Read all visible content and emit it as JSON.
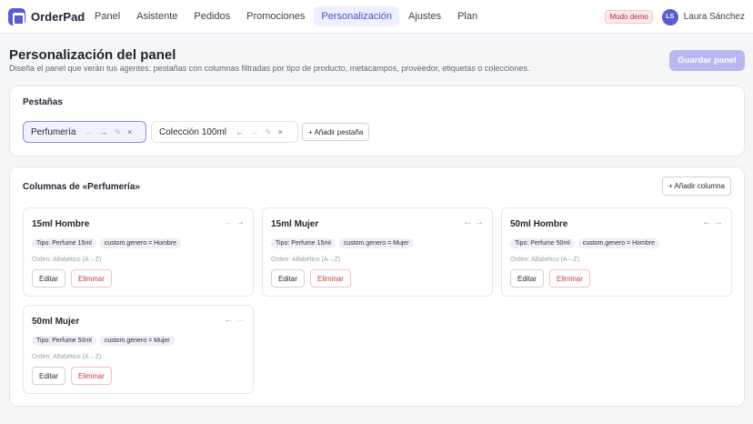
{
  "app": {
    "name": "OrderPad"
  },
  "nav": {
    "items": [
      {
        "label": "Panel"
      },
      {
        "label": "Asistente"
      },
      {
        "label": "Pedidos"
      },
      {
        "label": "Promociones"
      },
      {
        "label": "Personalización"
      },
      {
        "label": "Ajustes"
      },
      {
        "label": "Plan"
      }
    ],
    "active": "Personalización"
  },
  "user": {
    "demo_badge": "Modo demo",
    "initials": "LS",
    "name": "Laura Sánchez"
  },
  "header": {
    "title": "Personalización del panel",
    "subtitle": "Diseña el panel que verán tus agentes: pestañas con columnas filtradas por tipo de producto, metacampos, proveedor, etiquetas o colecciones.",
    "save_label": "Guardar panel"
  },
  "tabs_section": {
    "title": "Pestañas",
    "tabs": [
      {
        "label": "Perfumería",
        "active": true
      },
      {
        "label": "Colección 100ml",
        "active": false
      }
    ],
    "add_label": "+ Añadir pestaña",
    "controls": {
      "left": "←",
      "right": "→",
      "edit": "✎",
      "remove": "×"
    }
  },
  "columns_section": {
    "title": "Columnas de «Perfumería»",
    "add_label": "+ Añadir columna",
    "edit_label": "Editar",
    "delete_label": "Eliminar",
    "arrow_left": "←",
    "arrow_right": "→",
    "columns": [
      {
        "name": "15ml Hombre",
        "filters": [
          "Tipo: Perfume 15ml",
          "custom.genero = Hombre"
        ],
        "order": "Orden: Alfabético (A→Z)"
      },
      {
        "name": "15ml Mujer",
        "filters": [
          "Tipo: Perfume 15ml",
          "custom.genero = Mujer"
        ],
        "order": "Orden: Alfabético (A→Z)"
      },
      {
        "name": "50ml Hombre",
        "filters": [
          "Tipo: Perfume 50ml",
          "custom.genero = Hombre"
        ],
        "order": "Orden: Alfabético (A→Z)"
      },
      {
        "name": "50ml Mujer",
        "filters": [
          "Tipo: Perfume 50ml",
          "custom.genero = Mujer"
        ],
        "order": "Orden: Alfabético (A→Z)"
      }
    ]
  },
  "colors": {
    "accent": "#5b5bd6",
    "accent_light": "#b8b8f1",
    "danger": "#d13a41"
  }
}
